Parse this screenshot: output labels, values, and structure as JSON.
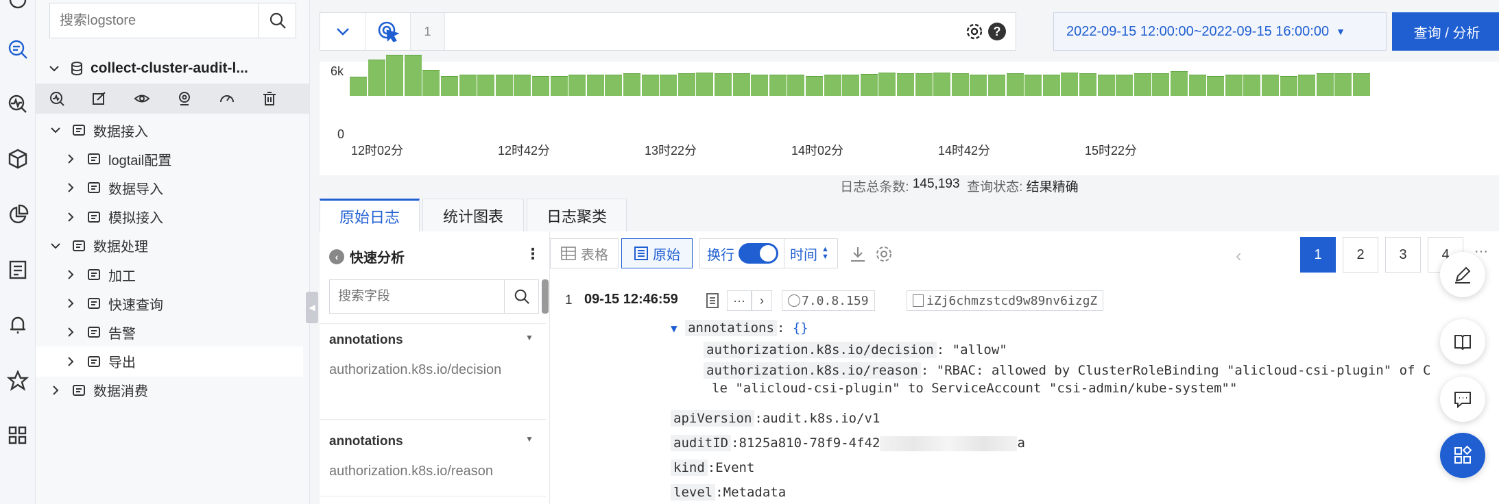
{
  "sidebar": {
    "search_placeholder": "搜索logstore",
    "project": "collect-cluster-audit-l...",
    "tree": [
      {
        "label": "数据接入",
        "level": 1,
        "expanded": true
      },
      {
        "label": "logtail配置",
        "level": 2
      },
      {
        "label": "数据导入",
        "level": 2
      },
      {
        "label": "模拟接入",
        "level": 2
      },
      {
        "label": "数据处理",
        "level": 1,
        "expanded": true
      },
      {
        "label": "加工",
        "level": 2
      },
      {
        "label": "快速查询",
        "level": 2
      },
      {
        "label": "告警",
        "level": 2
      },
      {
        "label": "导出",
        "level": 2,
        "selected": true
      },
      {
        "label": "数据消费",
        "level": 1
      }
    ]
  },
  "query": {
    "line_number": "1",
    "time_range": "2022-09-15 12:00:00~2022-09-15 16:00:00",
    "query_button": "查询 / 分析"
  },
  "histogram": {
    "y_max_label": "6k",
    "y_min_label": "0",
    "x_labels": [
      "12时02分",
      "12时42分",
      "13时22分",
      "14时02分",
      "14时42分",
      "15时22分"
    ],
    "values": [
      0.45,
      0.86,
      0.96,
      0.96,
      0.61,
      0.47,
      0.5,
      0.5,
      0.5,
      0.5,
      0.47,
      0.46,
      0.5,
      0.5,
      0.5,
      0.53,
      0.5,
      0.5,
      0.53,
      0.55,
      0.53,
      0.53,
      0.5,
      0.5,
      0.5,
      0.47,
      0.5,
      0.5,
      0.51,
      0.55,
      0.53,
      0.53,
      0.55,
      0.53,
      0.5,
      0.5,
      0.53,
      0.5,
      0.5,
      0.55,
      0.53,
      0.5,
      0.5,
      0.53,
      0.53,
      0.58,
      0.5,
      0.47,
      0.5,
      0.5,
      0.5,
      0.46,
      0.5,
      0.53,
      0.53,
      0.53
    ],
    "color": "#83c062"
  },
  "summary": {
    "total_label": "日志总条数:",
    "total_value": "145,193",
    "status_label": "查询状态:",
    "status_value": "结果精确"
  },
  "tabs": [
    "原始日志",
    "统计图表",
    "日志聚类"
  ],
  "quick_analysis": {
    "title": "快速分析",
    "search_placeholder": "搜索字段",
    "fields": [
      {
        "name": "annotations",
        "value": "authorization.k8s.io/decision"
      },
      {
        "name": "annotations",
        "value": "authorization.k8s.io/reason"
      }
    ]
  },
  "toolbar": {
    "table_label": "表格",
    "raw_label": "原始",
    "wrap_label": "换行",
    "time_label": "时间"
  },
  "pagination": [
    "1",
    "2",
    "3",
    "4"
  ],
  "log": {
    "index": "1",
    "time": "09-15 12:46:59",
    "ip": "7.0.8.159",
    "id": "iZj6chmzstcd9w89nv6izgZ",
    "annotations_key": "annotations",
    "annotations_val": "{}",
    "decision_key": "authorization.k8s.io/decision",
    "decision_val": "\"allow\"",
    "reason_key": "authorization.k8s.io/reason",
    "reason_val_1": "\"RBAC: allowed by ClusterRoleBinding \"alicloud-csi-plugin\" of C",
    "reason_val_2": "le \"alicloud-csi-plugin\" to ServiceAccount \"csi-admin/kube-system\"\"",
    "fields": [
      {
        "key": "apiVersion",
        "val": "audit.k8s.io/v1"
      },
      {
        "key": "auditID",
        "val": "8125a810-78f9-4f42",
        "tail": "a"
      },
      {
        "key": "kind",
        "val": "Event"
      },
      {
        "key": "level",
        "val": "Metadata"
      }
    ]
  },
  "colors": {
    "accent": "#1f5fd2",
    "bar": "#83c062"
  }
}
